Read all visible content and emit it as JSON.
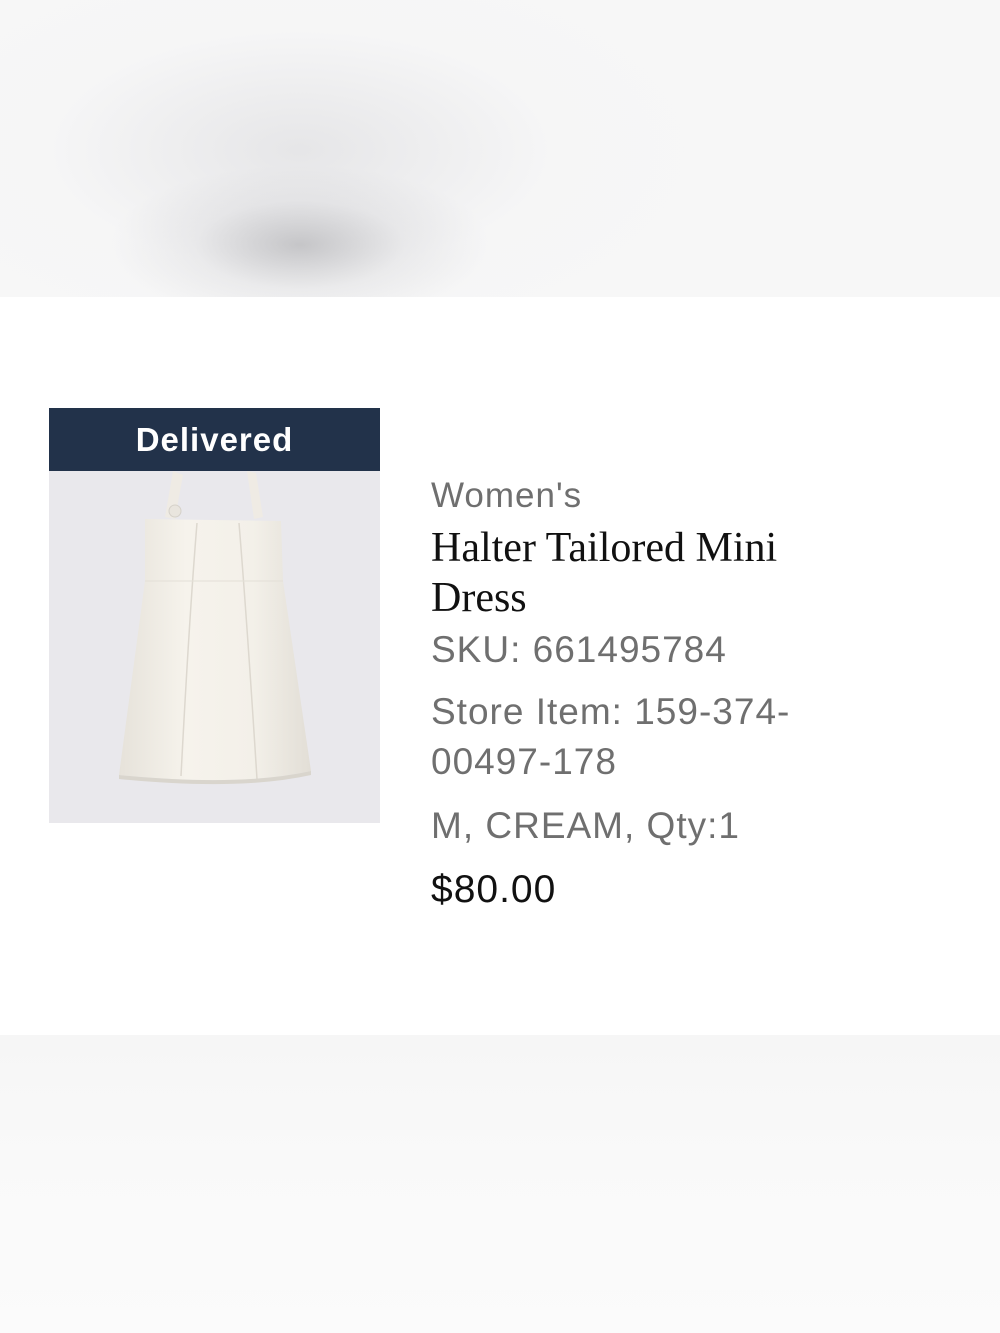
{
  "order_item": {
    "status": "Delivered",
    "category": "Women's",
    "product_name": "Halter Tailored Mini Dress",
    "sku": "SKU: 661495784",
    "store_item": "Store Item: 159-374-00497-178",
    "variant": "M, CREAM, Qty:1",
    "price": "$80.00",
    "image_icon": "dress-product-image",
    "colors": {
      "status_banner": "#22324a",
      "image_background": "#e9e8ec",
      "dress": "#f4f1ea"
    }
  }
}
